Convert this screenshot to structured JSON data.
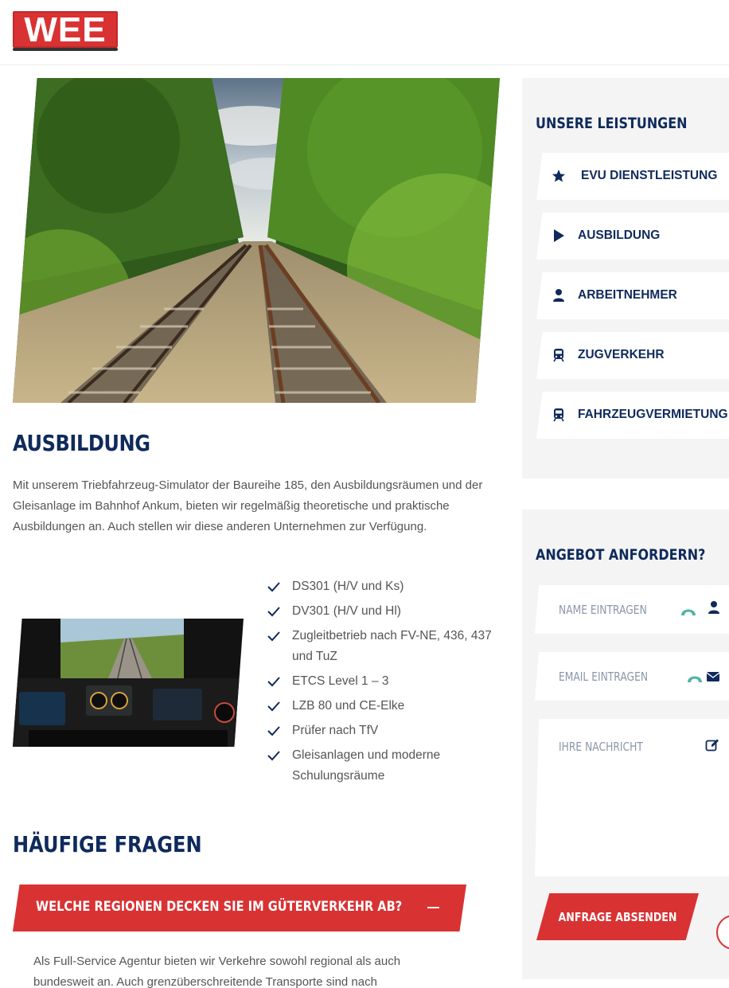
{
  "brand": {
    "logo_text": "WEE",
    "accent_color": "#d93233",
    "navy_color": "#0f2a5c"
  },
  "main": {
    "heading": "AUSBILDUNG",
    "intro": "Mit unserem Triebfahrzeug-Simulator der Baureihe 185, den Ausbildungsräumen und der Gleisanlage im Bahnhof Ankum, bieten wir regelmäßig theoretische und praktische Ausbildungen an. Auch stellen wir diese anderen Unternehmen zur Verfügung.",
    "checklist": [
      "DS301 (H/V und Ks)",
      "DV301 (H/V und Hl)",
      "Zugleitbetrieb nach FV-NE, 436, 437 und TuZ",
      "ETCS Level 1 – 3",
      "LZB 80 und CE-Elke",
      "Prüfer nach TfV",
      "Gleisanlagen und moderne Schulungsräume"
    ]
  },
  "faq": {
    "heading": "HÄUFIGE FRAGEN",
    "items": [
      {
        "question": "WELCHE REGIONEN DECKEN SIE IM GÜTERVERKEHR AB?",
        "answer": "Als Full-Service Agentur bieten wir Verkehre sowohl regional als auch bundesweit an. Auch grenzüberschreitende Transporte sind nach"
      }
    ]
  },
  "sidebar": {
    "services_title": "UNSERE LEISTUNGEN",
    "services": [
      {
        "label": "EVU DIENSTLEISTUNG",
        "icon": "star-icon"
      },
      {
        "label": "AUSBILDUNG",
        "icon": "play-icon"
      },
      {
        "label": "ARBEITNEHMER",
        "icon": "user-icon"
      },
      {
        "label": "ZUGVERKEHR",
        "icon": "train-icon"
      },
      {
        "label": "FAHRZEUGVERMIETUNG",
        "icon": "train-icon"
      }
    ],
    "form_title": "ANGEBOT ANFORDERN?",
    "form": {
      "name_placeholder": "NAME EINTRAGEN",
      "email_placeholder": "EMAIL EINTRAGEN",
      "message_placeholder": "IHRE NACHRICHT",
      "submit_label": "ANFRAGE ABSENDEN"
    }
  }
}
